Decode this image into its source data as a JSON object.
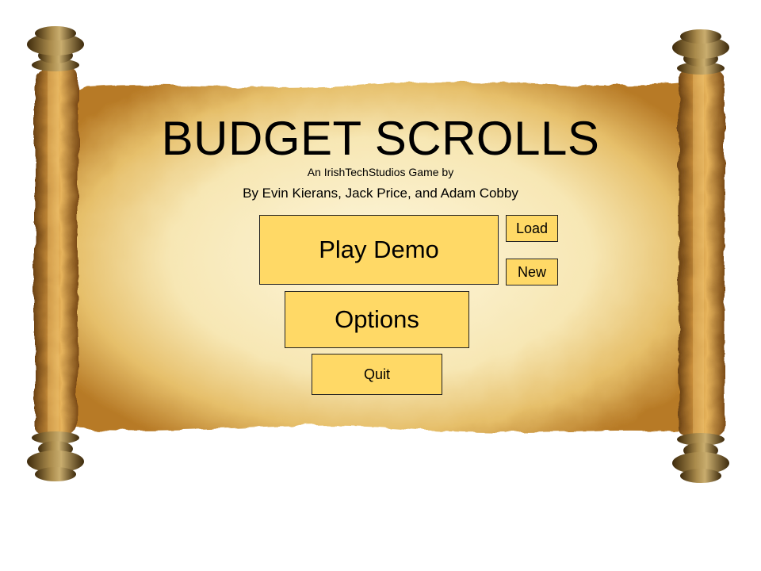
{
  "title": "BUDGET SCROLLS",
  "subtitle": "An IrishTechStudios Game by",
  "authors": "By Evin Kierans, Jack Price, and Adam Cobby",
  "menu": {
    "play_demo_label": "Play Demo",
    "load_label": "Load",
    "new_label": "New",
    "options_label": "Options",
    "quit_label": "Quit"
  },
  "colors": {
    "button_fill": "#ffd966",
    "parchment": "#f6e2a8",
    "parchment_edge": "#a9701e",
    "wood": "#8a6a2c"
  }
}
